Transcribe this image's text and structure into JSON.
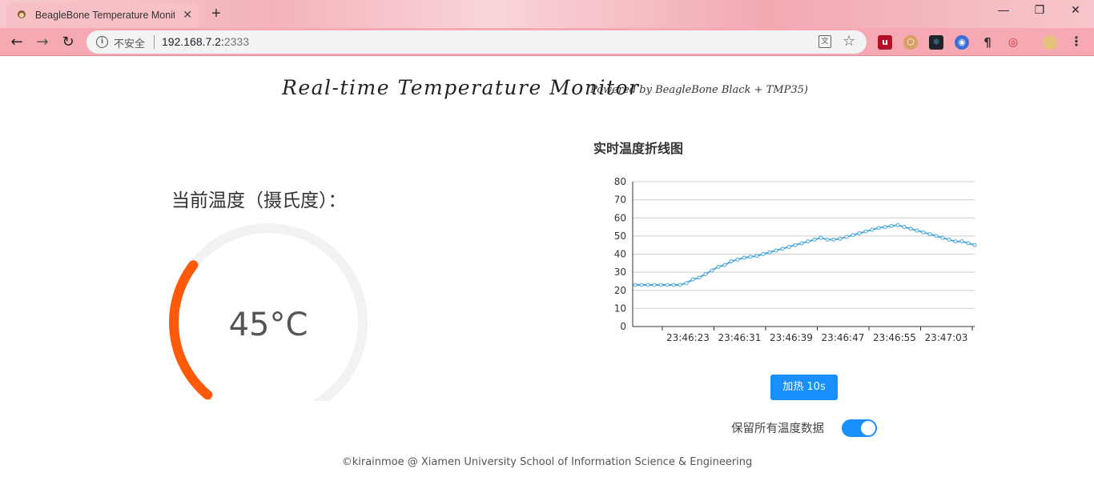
{
  "browser": {
    "tab_title": "BeagleBone Temperature Monitor",
    "new_tab": "+",
    "security_label": "不安全",
    "url_host": "192.168.7.2:",
    "url_port": "2333"
  },
  "page": {
    "title": "Real-time Temperature Monitor",
    "subtitle": "(Powered by BeagleBone Black + TMP35)",
    "gauge_label": "当前温度（摄氏度）：",
    "gauge_value": "45°C",
    "gauge_percent": 45,
    "chart_title": "实时温度折线图",
    "heat_button": "加热 10s",
    "keep_all_label": "保留所有温度数据",
    "keep_all_enabled": true,
    "footer": "©kirainmoe @ Xiamen University School of Information Science & Engineering"
  },
  "colors": {
    "gauge_fill": "#ff5a0a",
    "gauge_track": "#f2f2f2",
    "line": "#4aa8d8",
    "primary": "#1890ff"
  },
  "chart_data": {
    "type": "line",
    "ylim": [
      0,
      80
    ],
    "yticks": [
      0,
      10,
      20,
      30,
      40,
      50,
      60,
      70,
      80
    ],
    "xtick_labels": [
      "23:46:23",
      "23:46:31",
      "23:46:39",
      "23:46:47",
      "23:46:55",
      "23:47:03"
    ],
    "series": [
      {
        "values": [
          23,
          23,
          23,
          23,
          23,
          23,
          23,
          23,
          24,
          26,
          27,
          29,
          31,
          33,
          34,
          36,
          37,
          38,
          38.5,
          39,
          40,
          41,
          42,
          43,
          44,
          45,
          46,
          47,
          48,
          49,
          48,
          48,
          48.5,
          49.5,
          50.5,
          51.5,
          52.5,
          53.5,
          54.5,
          55,
          55.5,
          56,
          55,
          54,
          53,
          52,
          51,
          50,
          49,
          48,
          47,
          47,
          46,
          45
        ]
      }
    ]
  }
}
